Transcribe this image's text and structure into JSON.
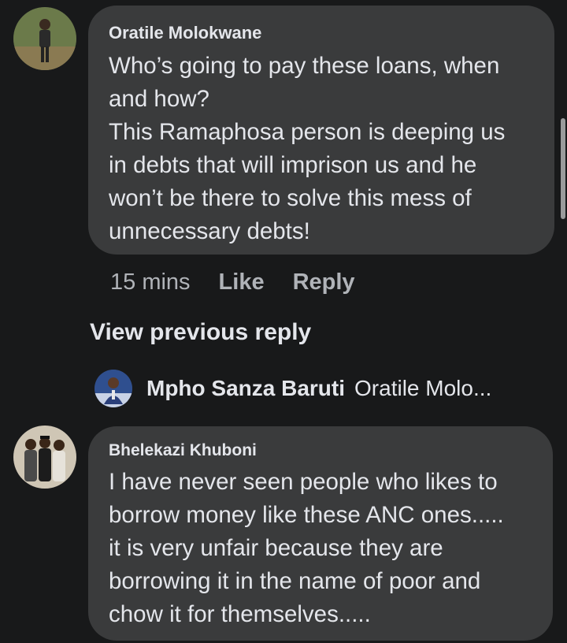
{
  "comments": [
    {
      "author": "Oratile Molokwane",
      "text": "Who’s going to pay these loans, when\nand how?\nThis Ramaphosa person is deeping us\nin debts that will imprison us and he\nwon’t be there to solve this mess of\nunnecessary debts!",
      "time": "15 mins",
      "like_label": "Like",
      "reply_label": "Reply"
    },
    {
      "author": "Bhelekazi Khuboni",
      "text": "I have never seen people who likes to\nborrow money like these ANC ones.....\nit is very unfair because they are\nborrowing it in the name of poor and\nchow it for themselves....."
    }
  ],
  "view_previous": "View previous reply",
  "reply_preview": {
    "name": "Mpho Sanza Baruti",
    "snippet": "Oratile Molo..."
  },
  "colors": {
    "background": "#18191a",
    "bubble": "#3a3b3c",
    "text": "#e4e6eb",
    "muted": "#b0b3b8"
  }
}
